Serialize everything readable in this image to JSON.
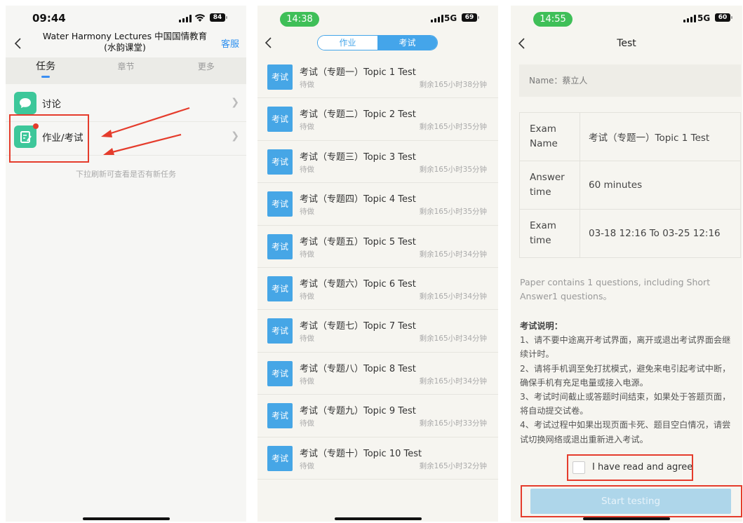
{
  "screen1": {
    "status": {
      "time": "09:44",
      "battery": "84"
    },
    "header": {
      "course_line1": "Water Harmony Lectures 中国国情教育",
      "course_line2": "(水韵课堂)",
      "service": "客服"
    },
    "tabs": [
      {
        "label": "任务"
      },
      {
        "label": "章节"
      },
      {
        "label": "更多"
      }
    ],
    "menu": [
      {
        "label": "讨论",
        "icon": "chat-bubble-icon"
      },
      {
        "label": "作业/考试",
        "icon": "edit-note-icon"
      }
    ],
    "hint": "下拉刷新可查看是否有新任务"
  },
  "screen2": {
    "status": {
      "time": "14:38",
      "network": "5G",
      "battery": "69"
    },
    "segments": [
      {
        "label": "作业"
      },
      {
        "label": "考试"
      }
    ],
    "exams": [
      {
        "tag": "考试",
        "title": "考试（专题一）Topic 1 Test",
        "status": "待做",
        "remaining": "剩余165小时38分钟"
      },
      {
        "tag": "考试",
        "title": "考试（专题二）Topic 2 Test",
        "status": "待做",
        "remaining": "剩余165小时35分钟"
      },
      {
        "tag": "考试",
        "title": "考试（专题三）Topic 3 Test",
        "status": "待做",
        "remaining": "剩余165小时35分钟"
      },
      {
        "tag": "考试",
        "title": "考试（专题四）Topic 4 Test",
        "status": "待做",
        "remaining": "剩余165小时35分钟"
      },
      {
        "tag": "考试",
        "title": "考试（专题五）Topic 5 Test",
        "status": "待做",
        "remaining": "剩余165小时34分钟"
      },
      {
        "tag": "考试",
        "title": "考试（专题六）Topic 6 Test",
        "status": "待做",
        "remaining": "剩余165小时34分钟"
      },
      {
        "tag": "考试",
        "title": "考试（专题七）Topic 7 Test",
        "status": "待做",
        "remaining": "剩余165小时34分钟"
      },
      {
        "tag": "考试",
        "title": "考试（专题八）Topic 8 Test",
        "status": "待做",
        "remaining": "剩余165小时34分钟"
      },
      {
        "tag": "考试",
        "title": "考试（专题九）Topic 9 Test",
        "status": "待做",
        "remaining": "剩余165小时33分钟"
      },
      {
        "tag": "考试",
        "title": "考试（专题十）Topic 10 Test",
        "status": "待做",
        "remaining": "剩余165小时32分钟"
      }
    ]
  },
  "screen3": {
    "status": {
      "time": "14:55",
      "network": "5G",
      "battery": "60"
    },
    "title": "Test",
    "name_line": "Name：蔡立人",
    "info": {
      "exam_name_label": "Exam Name",
      "exam_name_value": "考试（专题一）Topic 1 Test",
      "answer_time_label": "Answer time",
      "answer_time_value": "60 minutes",
      "exam_time_label": "Exam time",
      "exam_time_value": "03-18 12:16 To 03-25 12:16"
    },
    "paper_info": "Paper contains 1 questions, including Short Answer1 questions。",
    "instructions_title": "考试说明：",
    "instructions": [
      "1、请不要中途离开考试界面，离开或退出考试界面会继续计时。",
      "2、请将手机调至免打扰模式，避免来电引起考试中断，确保手机有充足电量或接入电源。",
      "3、考试时间截止或答题时间结束，如果处于答题页面，将自动提交试卷。",
      "4、考试过程中如果出现页面卡死、题目空白情况，请尝试切换网络或退出重新进入考试。"
    ],
    "agree_label": "I have read and agree",
    "start_button": "Start testing"
  },
  "colors": {
    "accent_blue": "#44a5ea",
    "highlight_red": "#e53c2c",
    "icon_green": "#3dc79a",
    "status_green": "#3fbf58"
  }
}
